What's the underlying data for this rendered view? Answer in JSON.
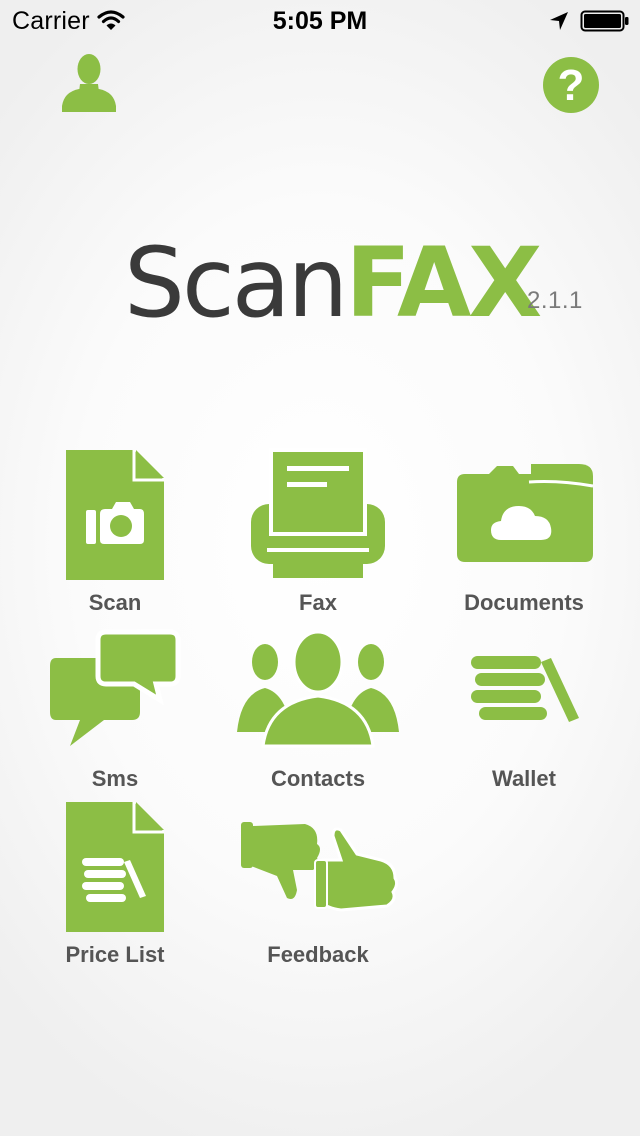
{
  "status_bar": {
    "carrier": "Carrier",
    "time": "5:05 PM",
    "icons": [
      "wifi-icon",
      "location-arrow-icon",
      "battery-icon"
    ]
  },
  "header": {
    "icons": [
      "profile-icon",
      "help-icon"
    ],
    "help_glyph": "?"
  },
  "logo": {
    "part1": "Scan",
    "part2": "FAX",
    "version": "2.1.1"
  },
  "menu": {
    "items": [
      {
        "label": "Scan",
        "icon": "scan-document-camera-icon"
      },
      {
        "label": "Fax",
        "icon": "fax-printer-icon"
      },
      {
        "label": "Documents",
        "icon": "cloud-folder-icon"
      },
      {
        "label": "Sms",
        "icon": "chat-bubbles-icon"
      },
      {
        "label": "Contacts",
        "icon": "people-group-icon"
      },
      {
        "label": "Wallet",
        "icon": "coin-stack-icon"
      },
      {
        "label": "Price List",
        "icon": "price-list-document-icon"
      },
      {
        "label": "Feedback",
        "icon": "thumbs-up-down-icon"
      }
    ]
  },
  "colors": {
    "accent": "#8cbe45",
    "logo_dark": "#3a3a3a",
    "label_gray": "#555555",
    "version_gray": "#7a7a7a"
  }
}
